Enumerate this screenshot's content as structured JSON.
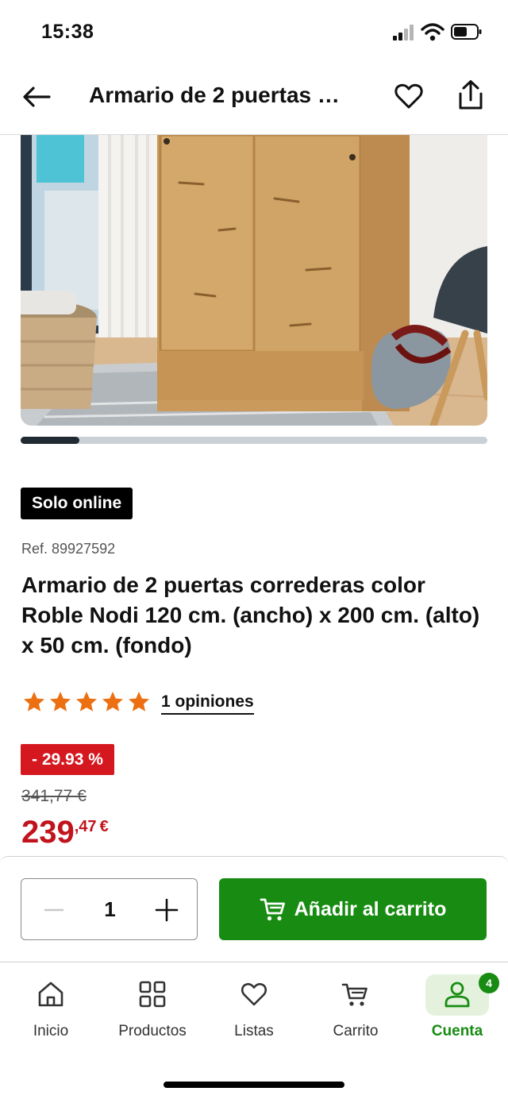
{
  "status_bar": {
    "time": "15:38"
  },
  "header": {
    "title": "Armario de 2 puertas correderas color Roble Nodi 120 cm. (ancho) x 200 cm. (alto) x 50 cm. (fondo)"
  },
  "gallery": {
    "icon": "product-photo-wardrobe",
    "current_fraction": 0.125
  },
  "product": {
    "badge": "Solo online",
    "ref": "Ref. 89927592",
    "title": "Armario de 2 puertas correderas color Roble Nodi 120 cm. (ancho) x 200 cm. (alto) x 50 cm. (fondo)",
    "rating": 5,
    "rating_max": 5,
    "opinions": "1 opiniones",
    "discount": "- 29.93 %",
    "old_price": "341,77 €",
    "price_int": "239",
    "price_dec": ",47",
    "price_currency": "€"
  },
  "purchase": {
    "quantity": "1",
    "add_label": "Añadir al carrito"
  },
  "nav": {
    "items": [
      {
        "label": "Inicio",
        "icon": "home-icon"
      },
      {
        "label": "Productos",
        "icon": "grid-icon"
      },
      {
        "label": "Listas",
        "icon": "heart-icon"
      },
      {
        "label": "Carrito",
        "icon": "cart-icon"
      },
      {
        "label": "Cuenta",
        "icon": "user-icon",
        "badge": "4",
        "active": true
      }
    ]
  },
  "colors": {
    "accent_green": "#188c12",
    "sale_red": "#d5171f",
    "price_red": "#c1131c",
    "star_orange": "#ec7012"
  }
}
